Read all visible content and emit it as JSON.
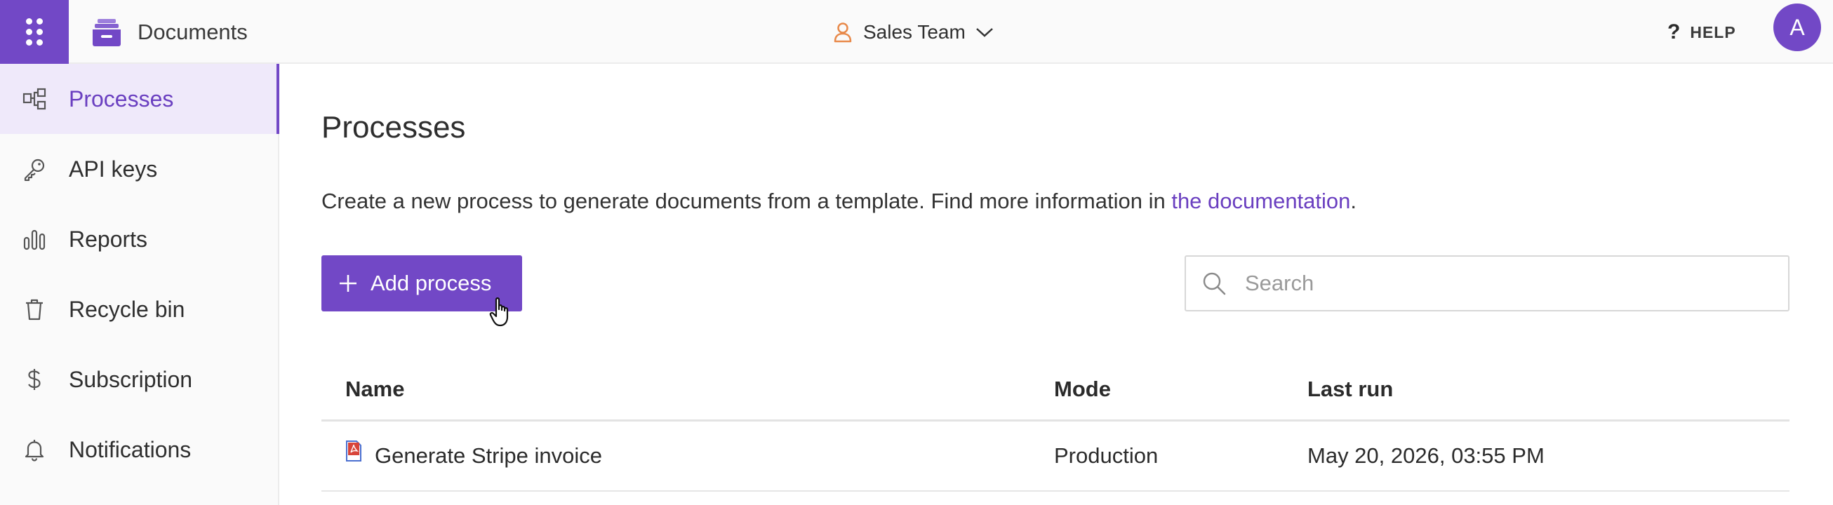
{
  "topbar": {
    "apps_icon": "grid-dots-icon",
    "brand": {
      "icon": "documents-tray-icon",
      "label": "Documents"
    },
    "team": {
      "icon": "person-icon",
      "label": "Sales Team",
      "dropdown_icon": "chevron-down-icon"
    },
    "help": {
      "icon": "question-icon",
      "label": "HELP"
    },
    "avatar": {
      "initial": "A"
    }
  },
  "sidebar": {
    "items": [
      {
        "label": "Processes",
        "icon": "process-flow-icon",
        "active": true
      },
      {
        "label": "API keys",
        "icon": "key-icon",
        "active": false
      },
      {
        "label": "Reports",
        "icon": "bar-chart-icon",
        "active": false
      },
      {
        "label": "Recycle bin",
        "icon": "trash-icon",
        "active": false
      },
      {
        "label": "Subscription",
        "icon": "dollar-icon",
        "active": false
      },
      {
        "label": "Notifications",
        "icon": "bell-icon",
        "active": false
      }
    ]
  },
  "main": {
    "title": "Processes",
    "intro_text": "Create a new process to generate documents from a template. Find more information in ",
    "intro_link": "the documentation",
    "intro_end": ".",
    "add_button": {
      "label": "Add process",
      "icon": "plus-icon"
    },
    "search": {
      "placeholder": "Search",
      "value": "",
      "icon": "search-icon"
    },
    "table": {
      "headers": {
        "name": "Name",
        "mode": "Mode",
        "last_run": "Last run"
      },
      "rows": [
        {
          "icon": "pdf-file-icon",
          "name": "Generate Stripe invoice",
          "mode": "Production",
          "last_run": "May 20, 2026, 03:55 PM"
        }
      ]
    }
  },
  "colors": {
    "accent": "#7248c6",
    "accent_text": "#6a3fc0",
    "active_bg": "#efe9fa",
    "team_icon": "#e8894a",
    "pdf_red": "#d8453a",
    "pdf_blue": "#4a6fd0"
  }
}
